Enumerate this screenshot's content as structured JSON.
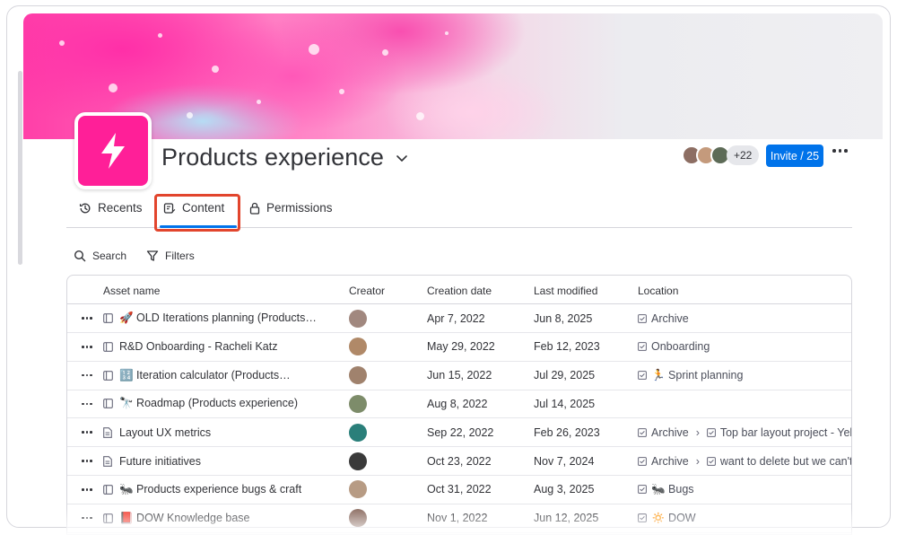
{
  "workspace": {
    "title": "Products experience",
    "brand_color": "#ff1f98"
  },
  "header": {
    "extra_members": "+22",
    "invite_label": "Invite / 25"
  },
  "tabs": [
    {
      "label": "Recents",
      "icon": "history-icon"
    },
    {
      "label": "Content",
      "icon": "content-icon",
      "active": true
    },
    {
      "label": "Permissions",
      "icon": "lock-icon"
    }
  ],
  "toolbar": {
    "search_label": "Search",
    "filters_label": "Filters"
  },
  "table": {
    "columns": [
      "Asset name",
      "Creator",
      "Creation date",
      "Last modified",
      "Location"
    ],
    "rows": [
      {
        "name": "🚀 OLD Iterations planning (Products…",
        "created": "Apr 7, 2022",
        "modified": "Jun 8, 2025",
        "location": [
          "Archive"
        ],
        "type": "board"
      },
      {
        "name": "R&D Onboarding - Racheli Katz",
        "created": "May 29, 2022",
        "modified": "Feb 12, 2023",
        "location": [
          "Onboarding"
        ],
        "type": "board"
      },
      {
        "name": "🔢 Iteration calculator (Products…",
        "created": "Jun 15, 2022",
        "modified": "Jul 29, 2025",
        "location": [
          "🏃 Sprint planning"
        ],
        "type": "board"
      },
      {
        "name": "🔭 Roadmap (Products experience)",
        "created": "Aug 8, 2022",
        "modified": "Jul 14, 2025",
        "location": [],
        "type": "board"
      },
      {
        "name": "Layout UX metrics",
        "created": "Sep 22, 2022",
        "modified": "Feb 26, 2023",
        "location": [
          "Archive",
          "Top bar layout project - Yehuda"
        ],
        "type": "doc"
      },
      {
        "name": "Future initiatives",
        "created": "Oct 23, 2022",
        "modified": "Nov 7, 2024",
        "location": [
          "Archive",
          "want to delete but we can't"
        ],
        "type": "doc"
      },
      {
        "name": "🐜 Products experience bugs & craft",
        "created": "Oct 31, 2022",
        "modified": "Aug 3, 2025",
        "location": [
          "🐜 Bugs"
        ],
        "type": "board"
      },
      {
        "name": "📕 DOW Knowledge base",
        "created": "Nov 1, 2022",
        "modified": "Jun 12, 2025",
        "location": [
          "🔅 DOW"
        ],
        "type": "board"
      }
    ]
  },
  "colors": {
    "accent": "#0073ea",
    "highlight": "#e2452d"
  }
}
